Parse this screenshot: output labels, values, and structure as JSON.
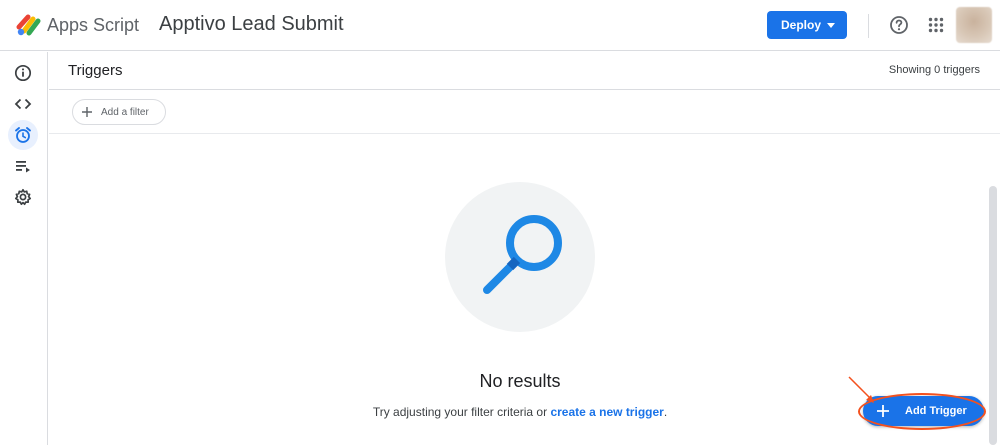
{
  "header": {
    "app_name": "Apps Script",
    "project_title": "Apptivo Lead Submit",
    "deploy_label": "Deploy",
    "icons": [
      "apps-script-logo",
      "help-icon",
      "apps-grid-icon",
      "avatar"
    ]
  },
  "rail": {
    "items": [
      {
        "name": "overview",
        "icon": "info-icon"
      },
      {
        "name": "editor",
        "icon": "code-icon"
      },
      {
        "name": "triggers",
        "icon": "alarm-clock-icon",
        "active": true
      },
      {
        "name": "executions",
        "icon": "executions-icon"
      },
      {
        "name": "settings",
        "icon": "gear-icon"
      }
    ]
  },
  "triggers": {
    "title": "Triggers",
    "showing": "Showing 0 triggers",
    "filter_label": "Add a filter"
  },
  "empty_state": {
    "title": "No results",
    "hint_prefix": "Try adjusting your filter criteria or ",
    "hint_link": "create a new trigger",
    "hint_suffix": "."
  },
  "fab": {
    "label": "Add Trigger"
  },
  "colors": {
    "accent": "#1a73e8",
    "annotation": "#f4511e"
  }
}
